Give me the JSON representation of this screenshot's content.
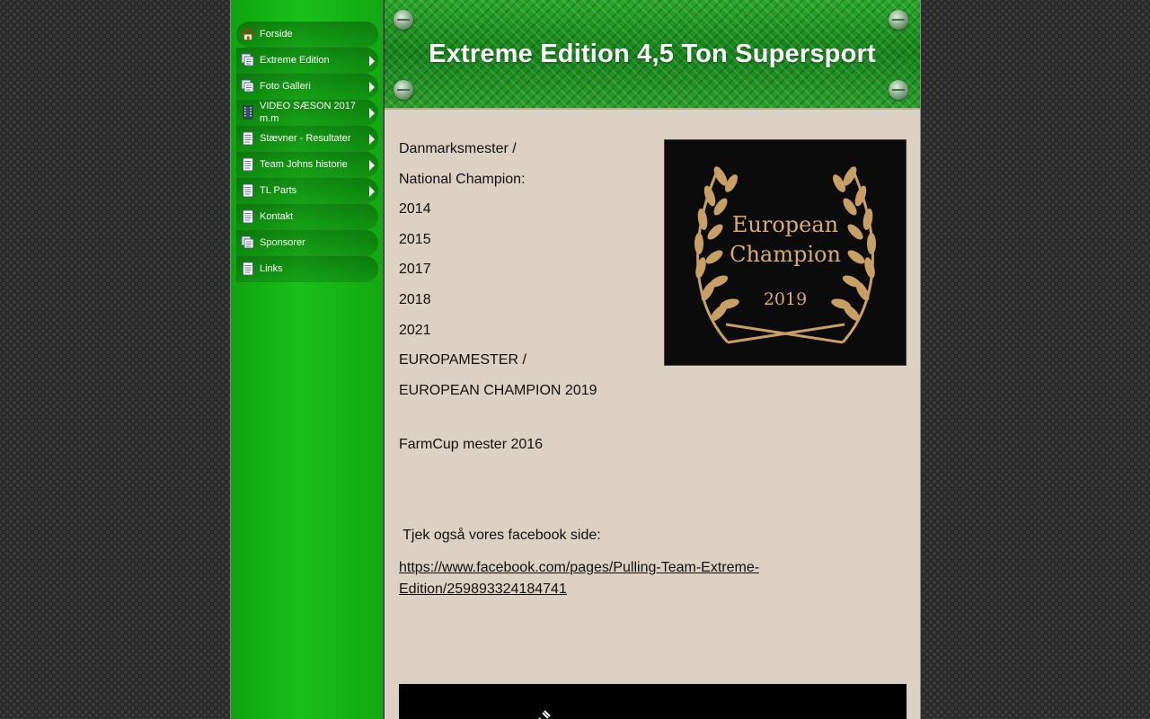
{
  "sidebar": {
    "items": [
      {
        "label": "Forside",
        "icon": "home-icon",
        "has_submenu": false
      },
      {
        "label": "Extreme Edition",
        "icon": "pages-icon",
        "has_submenu": true
      },
      {
        "label": "Foto Galleri",
        "icon": "pages-icon",
        "has_submenu": true
      },
      {
        "label": "VIDEO SÆSON 2017 m.m",
        "icon": "film-icon",
        "has_submenu": true
      },
      {
        "label": "Stævner - Resultater",
        "icon": "page-icon",
        "has_submenu": true
      },
      {
        "label": "Team Johns historie",
        "icon": "page-icon",
        "has_submenu": true
      },
      {
        "label": "TL Parts",
        "icon": "page-icon",
        "has_submenu": true
      },
      {
        "label": "Kontakt",
        "icon": "page-icon",
        "has_submenu": false
      },
      {
        "label": "Sponsorer",
        "icon": "pages-icon",
        "has_submenu": false
      },
      {
        "label": "Links",
        "icon": "page-icon",
        "has_submenu": false
      }
    ]
  },
  "header": {
    "title": "Extreme Edition 4,5 Ton Supersport"
  },
  "main": {
    "lines": [
      "Danmarksmester /",
      "National Champion:",
      "2014",
      "2015",
      "2017",
      "2018",
      "2021",
      "EUROPAMESTER /",
      "EUROPEAN CHAMPION 2019"
    ],
    "farmcup": "FarmCup mester 2016",
    "facebook_label": " Tjek også vores facebook side:",
    "facebook_link": "https://www.facebook.com/pages/Pulling-Team-Extreme-Edition/259893324184741"
  },
  "badge": {
    "line1": "European",
    "line2": "Champion",
    "year": "2019"
  },
  "colors": {
    "sidebar_green": "#19c019",
    "header_green": "#1f8d1f",
    "content_bg": "#dcd1c2",
    "badge_gold": "#d7ad6a"
  }
}
